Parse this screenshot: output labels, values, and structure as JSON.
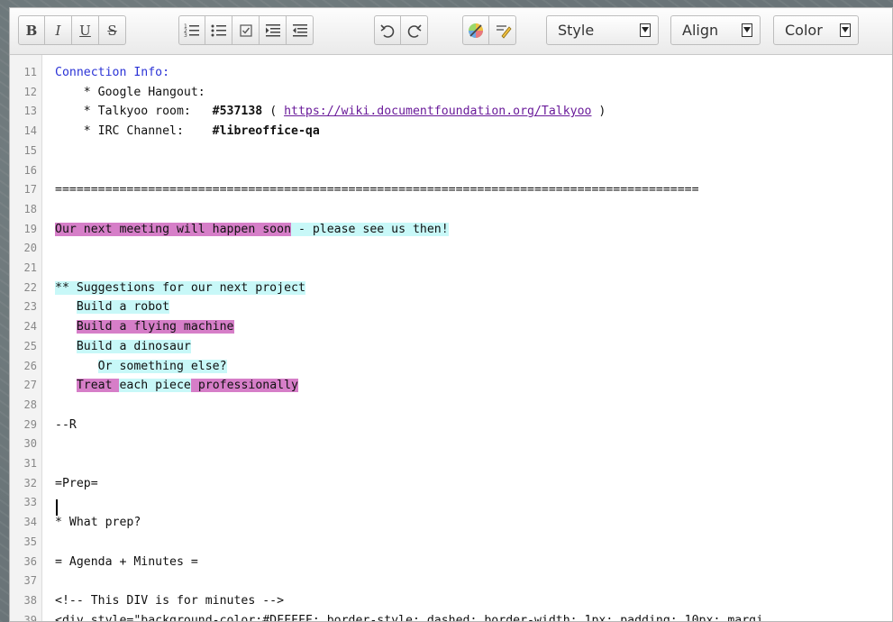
{
  "toolbar": {
    "bold": "B",
    "italic": "I",
    "underline": "U",
    "strike": "S",
    "style_label": "Style",
    "align_label": "Align",
    "color_label": "Color"
  },
  "lines": [
    {
      "n": "11",
      "segments": [
        {
          "t": "Connection Info:",
          "cls": "blue"
        }
      ]
    },
    {
      "n": "12",
      "segments": [
        {
          "t": "    * Google Hangout:"
        }
      ]
    },
    {
      "n": "13",
      "segments": [
        {
          "t": "    * Talkyoo room:   "
        },
        {
          "t": "#537138",
          "cls": "bold"
        },
        {
          "t": " ( "
        },
        {
          "t": "https://wiki.documentfoundation.org/Talkyoo",
          "cls": "link"
        },
        {
          "t": " )"
        }
      ]
    },
    {
      "n": "14",
      "segments": [
        {
          "t": "    * IRC Channel:    "
        },
        {
          "t": "#libreoffice-qa",
          "cls": "bold"
        }
      ]
    },
    {
      "n": "15",
      "segments": []
    },
    {
      "n": "16",
      "segments": []
    },
    {
      "n": "17",
      "segments": [
        {
          "t": "=========================================================================================="
        }
      ]
    },
    {
      "n": "18",
      "segments": []
    },
    {
      "n": "19",
      "segments": [
        {
          "t": "Our next meeting will happen soon",
          "cls": "hl-pink"
        },
        {
          "t": " - please see us then!",
          "cls": "hl-cyan"
        }
      ]
    },
    {
      "n": "20",
      "segments": []
    },
    {
      "n": "21",
      "segments": []
    },
    {
      "n": "22",
      "segments": [
        {
          "t": "** Suggestions for our next project",
          "cls": "hl-cyan"
        }
      ]
    },
    {
      "n": "23",
      "segments": [
        {
          "t": "   "
        },
        {
          "t": "Build a robot",
          "cls": "hl-cyan"
        }
      ]
    },
    {
      "n": "24",
      "segments": [
        {
          "t": "   "
        },
        {
          "t": "Build a flying machine",
          "cls": "hl-pink"
        }
      ]
    },
    {
      "n": "25",
      "segments": [
        {
          "t": "   "
        },
        {
          "t": "Build a dinosaur",
          "cls": "hl-cyan"
        }
      ]
    },
    {
      "n": "26",
      "segments": [
        {
          "t": "      "
        },
        {
          "t": "Or something else?",
          "cls": "hl-cyan"
        }
      ]
    },
    {
      "n": "27",
      "segments": [
        {
          "t": "   "
        },
        {
          "t": "Treat ",
          "cls": "hl-pink"
        },
        {
          "t": "each piece",
          "cls": "hl-cyan"
        },
        {
          "t": " professionally",
          "cls": "hl-pink"
        }
      ]
    },
    {
      "n": "28",
      "segments": []
    },
    {
      "n": "29",
      "segments": [
        {
          "t": "--R"
        }
      ]
    },
    {
      "n": "30",
      "segments": []
    },
    {
      "n": "31",
      "segments": []
    },
    {
      "n": "32",
      "segments": [
        {
          "t": "=Prep="
        }
      ]
    },
    {
      "n": "33",
      "segments": []
    },
    {
      "n": "34",
      "segments": [
        {
          "t": "* What prep?"
        }
      ]
    },
    {
      "n": "35",
      "segments": []
    },
    {
      "n": "36",
      "segments": [
        {
          "t": "= Agenda + Minutes ="
        }
      ]
    },
    {
      "n": "37",
      "segments": []
    },
    {
      "n": "38",
      "segments": [
        {
          "t": "<!-- This DIV is for minutes -->"
        }
      ]
    },
    {
      "n": "39",
      "segments": [
        {
          "t": "<div style=\"background-color:#DFFFFF; border-style: dashed; border-width: 1px; padding: 10px; margi"
        }
      ]
    }
  ]
}
